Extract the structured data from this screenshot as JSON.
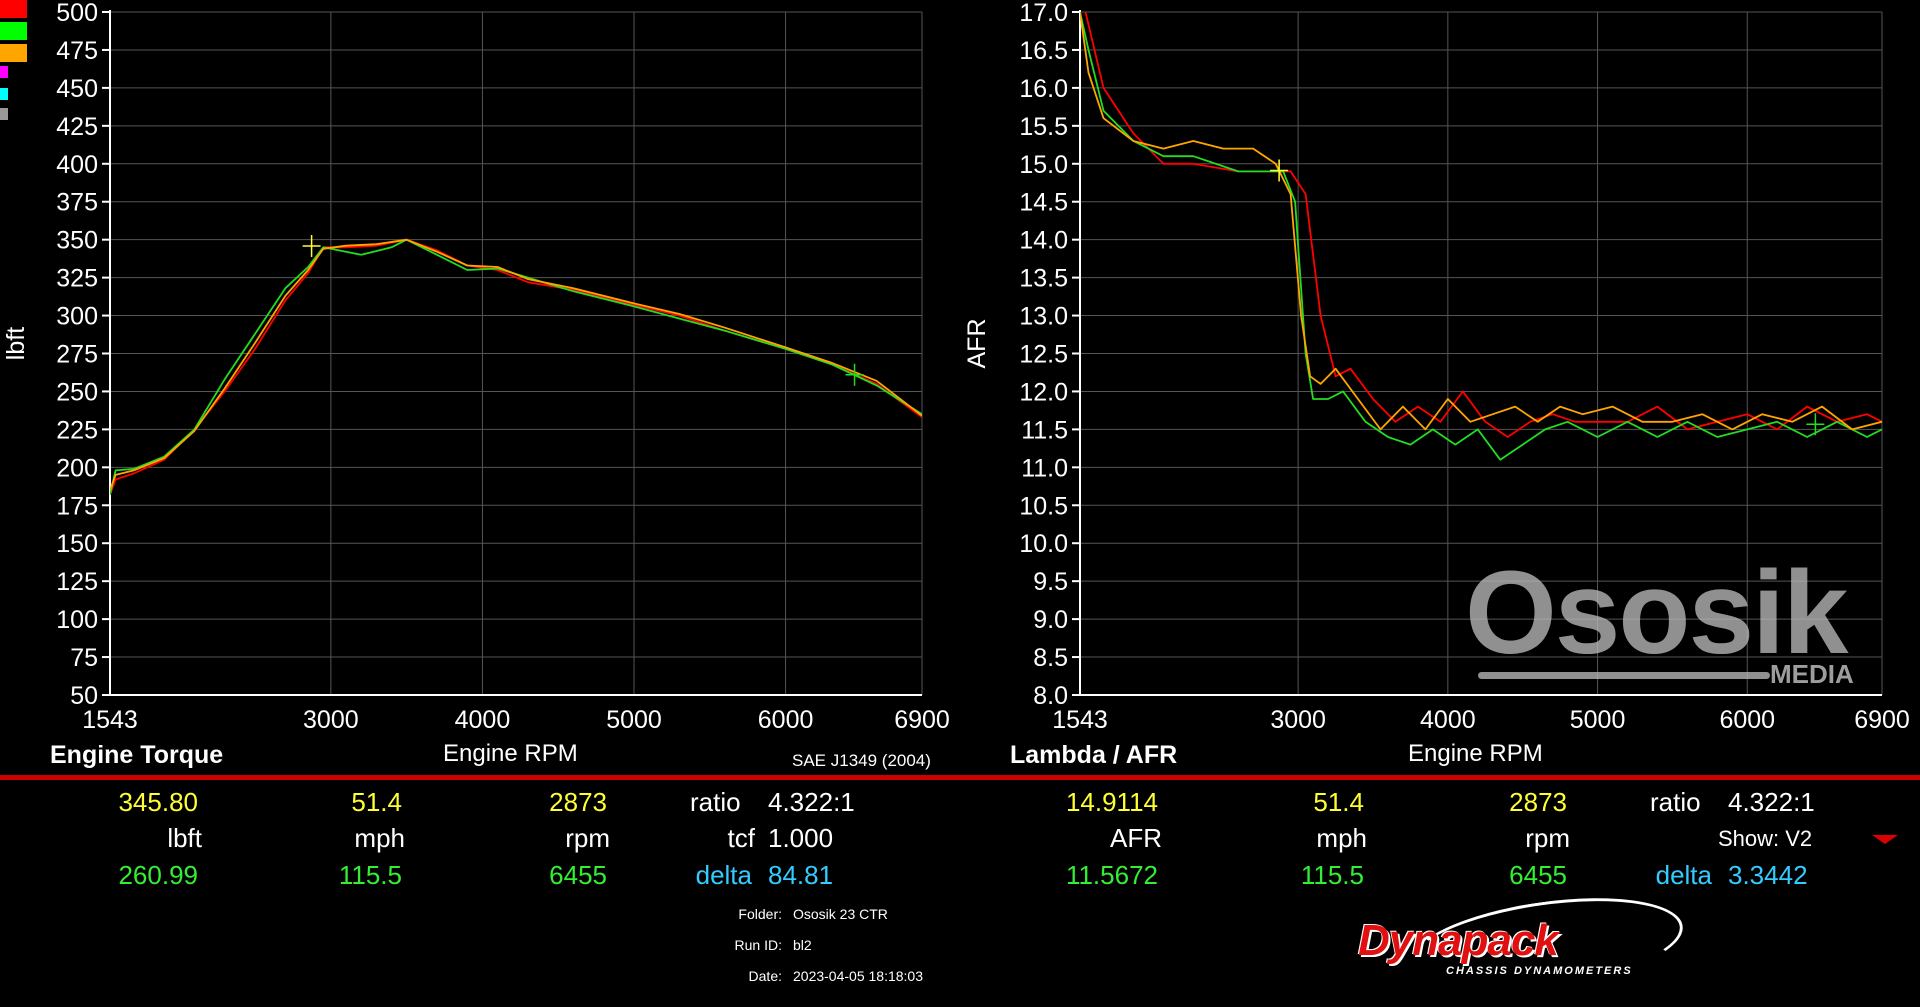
{
  "legend_colors": [
    "#ff0000",
    "#00ff00",
    "#ffa500",
    "#ff00ff",
    "#00ffff",
    "#999999"
  ],
  "colors": {
    "red": "#ff0000",
    "green": "#22dd22",
    "orange": "#ffa500",
    "yellow_cursor": "#ffff33",
    "bar": "#cc0000",
    "grid": "#555555"
  },
  "standard": "SAE J1349 (2004)",
  "chart_data": [
    {
      "type": "line",
      "title": "Engine Torque",
      "xlabel": "Engine RPM",
      "ylabel": "lbft",
      "xlim": [
        1543,
        6900
      ],
      "ylim": [
        50,
        500
      ],
      "x_ticks": [
        1543,
        3000,
        4000,
        5000,
        6000,
        6900
      ],
      "y_ticks": [
        50,
        75,
        100,
        125,
        150,
        175,
        200,
        225,
        250,
        275,
        300,
        325,
        350,
        375,
        400,
        425,
        450,
        475,
        500
      ],
      "grid": true,
      "series": [
        {
          "color": "#ff0000",
          "x": [
            1543,
            1580,
            1700,
            1900,
            2100,
            2300,
            2500,
            2700,
            2850,
            2950,
            3100,
            3300,
            3500,
            3700,
            3900,
            4100,
            4300,
            4600,
            5000,
            5300,
            5600,
            6000,
            6300,
            6600,
            6900
          ],
          "y": [
            182,
            192,
            196,
            205,
            225,
            250,
            278,
            310,
            328,
            345,
            345,
            346,
            350,
            343,
            333,
            330,
            322,
            317,
            307,
            300,
            290,
            278,
            268,
            255,
            233
          ]
        },
        {
          "color": "#22dd22",
          "x": [
            1543,
            1580,
            1700,
            1900,
            2100,
            2300,
            2500,
            2700,
            2850,
            2950,
            3100,
            3200,
            3400,
            3500,
            3700,
            3900,
            4100,
            4300,
            4600,
            5000,
            5300,
            5600,
            6000,
            6300,
            6600,
            6900
          ],
          "y": [
            182,
            198,
            199,
            207,
            225,
            258,
            288,
            318,
            332,
            345,
            342,
            340,
            345,
            350,
            340,
            330,
            331,
            325,
            316,
            306,
            298,
            290,
            278,
            268,
            254,
            235
          ]
        },
        {
          "color": "#ffa500",
          "x": [
            1543,
            1580,
            1700,
            1900,
            2100,
            2300,
            2500,
            2700,
            2850,
            2950,
            3100,
            3300,
            3500,
            3700,
            3900,
            4100,
            4300,
            4600,
            5000,
            5300,
            5600,
            6000,
            6300,
            6600,
            6900
          ],
          "y": [
            185,
            195,
            198,
            206,
            224,
            252,
            282,
            313,
            330,
            344,
            346,
            347,
            350,
            342,
            333,
            332,
            324,
            318,
            308,
            301,
            292,
            279,
            269,
            257,
            234
          ]
        }
      ],
      "cursors": [
        {
          "x": 2873,
          "y": 345.8
        },
        {
          "x": 6455,
          "y": 260.99
        }
      ]
    },
    {
      "type": "line",
      "title": "Lambda / AFR",
      "xlabel": "Engine RPM",
      "ylabel": "AFR",
      "xlim": [
        1543,
        6900
      ],
      "ylim": [
        8.0,
        17.0
      ],
      "x_ticks": [
        1543,
        3000,
        4000,
        5000,
        6000,
        6900
      ],
      "y_ticks": [
        8.0,
        8.5,
        9.0,
        9.5,
        10.0,
        10.5,
        11.0,
        11.5,
        12.0,
        12.5,
        13.0,
        13.5,
        14.0,
        14.5,
        15.0,
        15.5,
        16.0,
        16.5,
        17.0
      ],
      "grid": true,
      "series": [
        {
          "color": "#ff0000",
          "x": [
            1580,
            1700,
            1900,
            2100,
            2300,
            2600,
            2800,
            2950,
            3050,
            3150,
            3250,
            3350,
            3500,
            3650,
            3800,
            3950,
            4100,
            4250,
            4400,
            4550,
            4700,
            4850,
            5000,
            5200,
            5400,
            5600,
            5800,
            6000,
            6200,
            6400,
            6600,
            6800,
            6900
          ],
          "y": [
            17.0,
            16.0,
            15.4,
            15.0,
            15.0,
            14.9,
            14.9,
            14.9,
            14.6,
            13.0,
            12.2,
            12.3,
            11.9,
            11.6,
            11.8,
            11.6,
            12.0,
            11.6,
            11.4,
            11.6,
            11.7,
            11.6,
            11.6,
            11.6,
            11.8,
            11.5,
            11.6,
            11.7,
            11.5,
            11.8,
            11.6,
            11.7,
            11.6
          ]
        },
        {
          "color": "#22dd22",
          "x": [
            1543,
            1600,
            1700,
            1900,
            2100,
            2300,
            2600,
            2800,
            2900,
            2980,
            3050,
            3100,
            3200,
            3300,
            3450,
            3600,
            3750,
            3900,
            4050,
            4200,
            4350,
            4500,
            4650,
            4800,
            5000,
            5200,
            5400,
            5600,
            5800,
            6000,
            6200,
            6400,
            6600,
            6800,
            6900
          ],
          "y": [
            17.0,
            16.5,
            15.7,
            15.3,
            15.1,
            15.1,
            14.9,
            14.9,
            14.9,
            14.5,
            12.5,
            11.9,
            11.9,
            12.0,
            11.6,
            11.4,
            11.3,
            11.5,
            11.3,
            11.5,
            11.1,
            11.3,
            11.5,
            11.6,
            11.4,
            11.6,
            11.4,
            11.6,
            11.4,
            11.5,
            11.6,
            11.4,
            11.6,
            11.4,
            11.5
          ]
        },
        {
          "color": "#ffa500",
          "x": [
            1543,
            1600,
            1700,
            1900,
            2100,
            2300,
            2500,
            2700,
            2850,
            2950,
            3020,
            3080,
            3150,
            3250,
            3400,
            3550,
            3700,
            3850,
            4000,
            4150,
            4300,
            4450,
            4600,
            4750,
            4900,
            5100,
            5300,
            5500,
            5700,
            5900,
            6100,
            6300,
            6500,
            6700,
            6900
          ],
          "y": [
            17.0,
            16.2,
            15.6,
            15.3,
            15.2,
            15.3,
            15.2,
            15.2,
            15.0,
            14.6,
            13.0,
            12.2,
            12.1,
            12.3,
            11.9,
            11.5,
            11.8,
            11.5,
            11.9,
            11.6,
            11.7,
            11.8,
            11.6,
            11.8,
            11.7,
            11.8,
            11.6,
            11.6,
            11.7,
            11.5,
            11.7,
            11.6,
            11.8,
            11.5,
            11.6
          ]
        }
      ],
      "cursors": [
        {
          "x": 2873,
          "y": 14.9114
        },
        {
          "x": 6455,
          "y": 11.5672
        }
      ]
    }
  ],
  "readouts": {
    "torque": {
      "cursor1_value": "345.80",
      "cursor1_mph": "51.4",
      "cursor1_rpm": "2873",
      "unit_value": "lbft",
      "unit_mph": "mph",
      "unit_rpm": "rpm",
      "cursor2_value": "260.99",
      "cursor2_mph": "115.5",
      "cursor2_rpm": "6455",
      "ratio_label": "ratio",
      "ratio_value": "4.322:1",
      "tcf_label": "tcf",
      "tcf_value": "1.000",
      "delta_label": "delta",
      "delta_value": "84.81"
    },
    "afr": {
      "cursor1_value": "14.9114",
      "cursor1_mph": "51.4",
      "cursor1_rpm": "2873",
      "unit_value": "AFR",
      "unit_mph": "mph",
      "unit_rpm": "rpm",
      "cursor2_value": "11.5672",
      "cursor2_mph": "115.5",
      "cursor2_rpm": "6455",
      "ratio_label": "ratio",
      "ratio_value": "4.322:1",
      "show_label": "Show: V2",
      "delta_label": "delta",
      "delta_value": "3.3442"
    }
  },
  "info": {
    "folder_label": "Folder:",
    "folder_value": "Ososik 23 CTR",
    "run_label": "Run ID:",
    "run_value": "bl2",
    "date_label": "Date:",
    "date_value": "2023-04-05 18:18:03"
  },
  "watermark": {
    "name": "Ososik",
    "sub": "MEDIA"
  },
  "brand": {
    "name": "Dynapack",
    "tagline": "CHASSIS DYNAMOMETERS"
  }
}
